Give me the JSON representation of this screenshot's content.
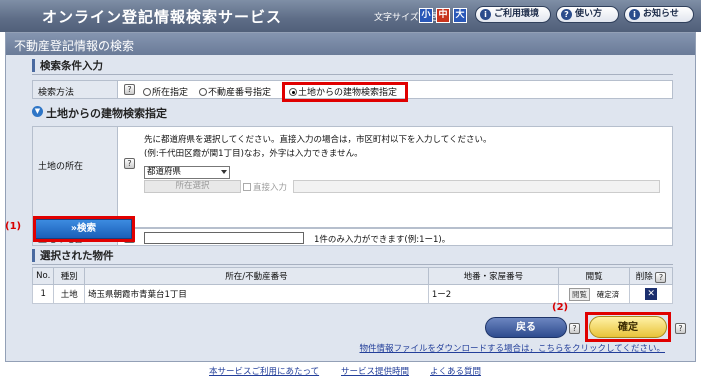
{
  "header": {
    "title": "オンライン登記情報検索サービス",
    "font_size_label": "文字サイズ変更",
    "font_sizes": [
      "小",
      "中",
      "大"
    ],
    "env_label": "ご利用環境",
    "help_label": "使い方",
    "news_label": "お知らせ"
  },
  "panel": {
    "title": "不動産登記情報の検索",
    "section_conditions": "検索条件入力",
    "method_label": "検索方法",
    "methods": [
      "所在指定",
      "不動産番号指定",
      "土地からの建物検索指定"
    ],
    "selected_method": "土地からの建物検索指定",
    "subsection": "土地からの建物検索指定",
    "location_label": "土地の所在",
    "note_line1": "先に都道府県を選択してください。直接入力の場合は，市区町村以下を入力してください。",
    "note_line2": "(例:千代田区霞が関1丁目)なお，外字は入力できません。",
    "pref_select": "都道府県",
    "loc_select_btn": "所在選択",
    "direct_input_label": "直接入力",
    "lot_label": "土地の地番",
    "lot_value": "",
    "lot_note": "1件のみ入力ができます(例:1ー1)。",
    "search_btn": "»検索",
    "marker_1": "(1)",
    "section_selected": "選択された物件",
    "table": {
      "headers": [
        "No.",
        "種別",
        "所在/不動産番号",
        "地番・家屋番号",
        "閲覧",
        "削除"
      ],
      "rows": [
        {
          "no": "1",
          "type": "土地",
          "location": "埼玉県朝霞市青葉台1丁目",
          "lot": "1ー2",
          "browse": "閲覧",
          "status": "確定済",
          "delete": "✕"
        }
      ]
    },
    "back_btn": "戻る",
    "confirm_btn": "確定",
    "marker_2": "(2)",
    "download_link": "物件情報ファイルをダウンロードする場合は，こちらをクリックしてください。"
  },
  "footer": {
    "links": [
      "本サービスご利用にあたって",
      "サービス提供時間",
      "よくある質問"
    ]
  }
}
